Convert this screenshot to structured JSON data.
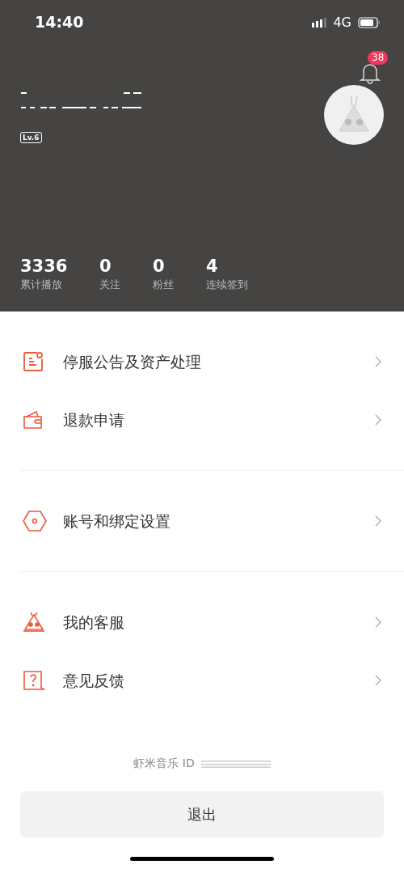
{
  "status_bar": {
    "time": "14:40",
    "network": "4G"
  },
  "header": {
    "notification_count": "38",
    "level_badge": "Lv.6"
  },
  "stats": [
    {
      "value": "3336",
      "label": "累计播放"
    },
    {
      "value": "0",
      "label": "关注"
    },
    {
      "value": "0",
      "label": "粉丝"
    },
    {
      "value": "4",
      "label": "连续签到"
    }
  ],
  "menu_groups": [
    [
      {
        "kind": "notice",
        "label": "停服公告及资产处理"
      },
      {
        "kind": "wallet",
        "label": "退款申请"
      }
    ],
    [
      {
        "kind": "hexagon",
        "label": "账号和绑定设置"
      }
    ],
    [
      {
        "kind": "mascot",
        "label": "我的客服"
      },
      {
        "kind": "question",
        "label": "意见反馈"
      }
    ]
  ],
  "footer": {
    "id_label": "虾米音乐 ID",
    "logout_button": "退出"
  }
}
